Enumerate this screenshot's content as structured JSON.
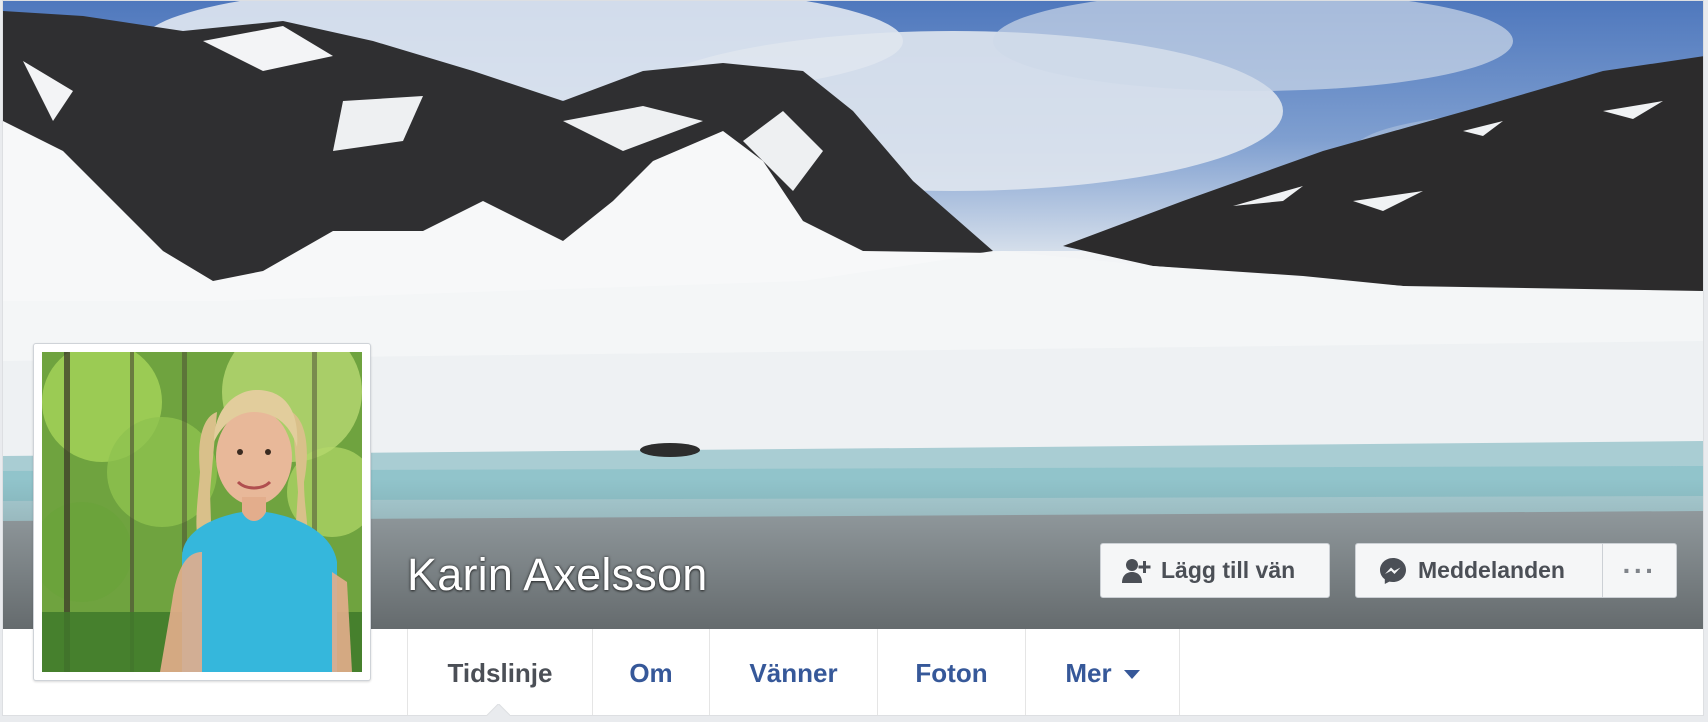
{
  "profile": {
    "name": "Karin Axelsson"
  },
  "actions": {
    "add_friend_label": "Lägg till vän",
    "message_label": "Meddelanden",
    "more_label": "···"
  },
  "tabs": [
    {
      "label": "Tidslinje",
      "active": true
    },
    {
      "label": "Om",
      "active": false
    },
    {
      "label": "Vänner",
      "active": false
    },
    {
      "label": "Foton",
      "active": false
    },
    {
      "label": "Mer",
      "active": false
    }
  ],
  "icons": {
    "add_friend": "add-friend-icon",
    "messenger": "messenger-icon",
    "more_dropdown": "caret-down-icon"
  },
  "colors": {
    "link_blue": "#365899",
    "active_tab_text": "#4b4f56",
    "button_bg": "#f5f6f7",
    "page_bg": "#e9ebee"
  }
}
